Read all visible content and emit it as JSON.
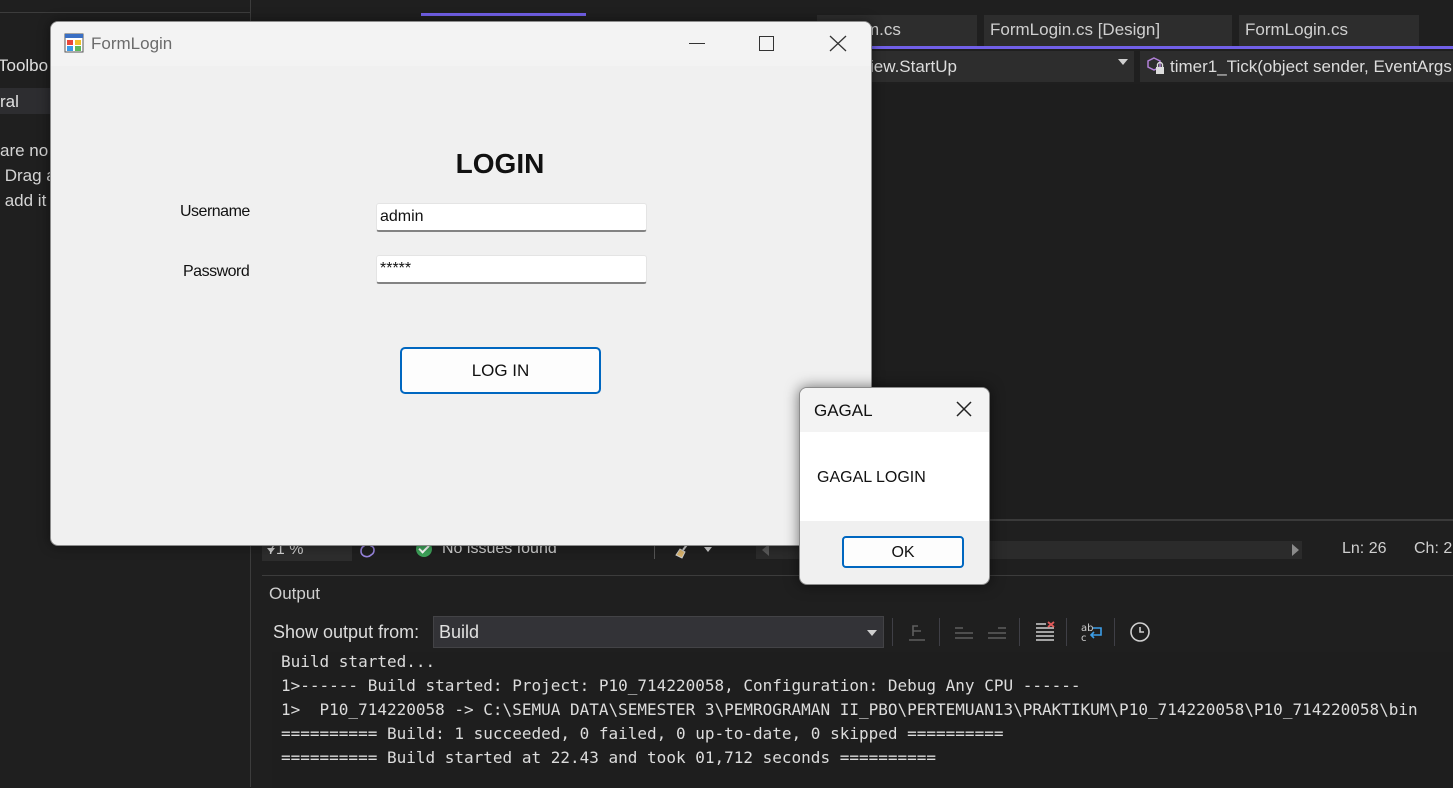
{
  "ide": {
    "left_panel": {
      "toolbox_title": "Toolbo",
      "general_label": "ral",
      "message_lines": [
        "are no",
        " Drag a",
        " add it"
      ]
    },
    "tabs": [
      {
        "label": "m.cs",
        "active": false
      },
      {
        "label": "FormLogin.cs [Design]",
        "active": false
      },
      {
        "label": "FormLogin.cs",
        "active": false
      }
    ],
    "nav_bar": {
      "class_selector": "iew.StartUp",
      "member_selector": "timer1_Tick(object sender, EventArgs e)"
    },
    "status_bar": {
      "zoom": "71 %",
      "issues_text": "No issues found",
      "line": "Ln: 26",
      "char": "Ch: 2"
    },
    "output": {
      "title": "Output",
      "show_from_label": "Show output from:",
      "source": "Build",
      "lines": [
        "Build started...",
        "1>------ Build started: Project: P10_714220058, Configuration: Debug Any CPU ------",
        "1>  P10_714220058 -> C:\\SEMUA DATA\\SEMESTER 3\\PEMROGRAMAN II_PBO\\PERTEMUAN13\\PRAKTIKUM\\P10_714220058\\P10_714220058\\bin",
        "========== Build: 1 succeeded, 0 failed, 0 up-to-date, 0 skipped ==========",
        "========== Build started at 22.43 and took 01,712 seconds =========="
      ]
    }
  },
  "form": {
    "title": "FormLogin",
    "heading": "LOGIN",
    "username_label": "Username",
    "username_value": "admin",
    "password_label": "Password",
    "password_value": "*****",
    "login_button": "LOG IN"
  },
  "message_box": {
    "title": "GAGAL",
    "message": "GAGAL LOGIN",
    "ok_button": "OK"
  },
  "colors": {
    "accent": "#7160e8",
    "button_border": "#0067c0",
    "ide_background": "#1f1f1f",
    "success": "#3ea35a"
  }
}
